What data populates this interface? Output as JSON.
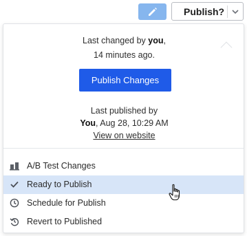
{
  "toolbar": {
    "edit_icon": "pencil-icon",
    "publish_label": "Publish?",
    "chevron_icon": "chevron-down-icon"
  },
  "dropdown": {
    "last_changed_prefix": "Last changed by ",
    "last_changed_user": "you",
    "last_changed_suffix": ",",
    "last_changed_time": "14 minutes ago.",
    "publish_changes_label": "Publish Changes",
    "last_published_label": "Last published by",
    "last_published_user": "You",
    "last_published_date": ", Aug 28, 10:29 AM",
    "view_link": "View on website",
    "menu": [
      {
        "label": "A/B Test Changes",
        "icon": "ab-test-icon",
        "selected": false
      },
      {
        "label": "Ready to Publish",
        "icon": "checkmark-icon",
        "selected": true
      },
      {
        "label": "Schedule for Publish",
        "icon": "clock-icon",
        "selected": false
      },
      {
        "label": "Revert to Published",
        "icon": "revert-icon",
        "selected": false
      }
    ]
  },
  "colors": {
    "primary": "#1f5be8",
    "edit_button": "#86b6ee",
    "selected_row": "#d7e5f8"
  }
}
